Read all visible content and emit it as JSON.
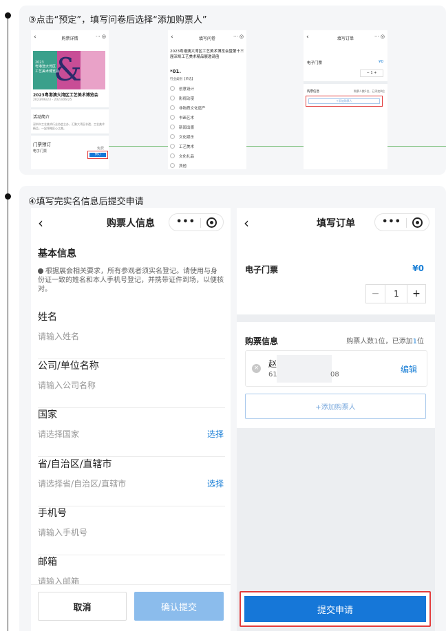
{
  "step3": {
    "title": "③点击“预定”，填写问卷后选择“添加购票人”",
    "screen1": {
      "header": "购票详情",
      "banner_year": "2023",
      "banner_line1": "粤港澳大湾区",
      "banner_line2": "工艺美术博览会",
      "event_title": "2023粤港澳大湾区工艺美术博览会",
      "date": "2023/06/23 - 2023/06/25",
      "intro_heading": "活动简介",
      "intro_text": "深圳市工艺美术行业协会主办，汇聚大湾区非遗、工艺美术精品，一起领略匠心之美。",
      "tickets_heading": "门票预订",
      "ticket_name": "电子门票",
      "price_tag": "免费",
      "book_button": "预订"
    },
    "screen2": {
      "header": "填写问卷",
      "heading": "2023粤港澳大湾区工艺美术博览会暨第十三届深圳工艺美术精品展邀请函",
      "question": "*01.",
      "question_sub": "行业类别【单选】",
      "options": [
        "创意设计",
        "影视动漫",
        "非物质文化遗产",
        "书画艺术",
        "新闻出版",
        "文化娱乐",
        "工艺美术",
        "文化礼品",
        "其他"
      ]
    },
    "screen3": {
      "header": "填写订单",
      "ticket_label": "电子门票",
      "price": "¥0",
      "qty": "1",
      "buyer_label": "购票信息",
      "buyer_count": "购票人数1位，已添加0位",
      "add_button": "+添加购票人"
    }
  },
  "step4": {
    "title": "④填写完实名信息后提交申请",
    "left_screen": {
      "header": "购票人信息",
      "section_title": "基本信息",
      "notice": "根据展会相关要求，所有参观者须实名登记。请使用与身份证一致的姓名和本人手机号登记，并携带证件到场，以便核对。",
      "fields": [
        {
          "label": "姓名",
          "placeholder": "请输入姓名",
          "action": ""
        },
        {
          "label": "公司/单位名称",
          "placeholder": "请输入公司名称",
          "action": ""
        },
        {
          "label": "国家",
          "placeholder": "请选择国家",
          "action": "选择"
        },
        {
          "label": "省/自治区/直辖市",
          "placeholder": "请选择省/自治区/直辖市",
          "action": "选择"
        },
        {
          "label": "手机号",
          "placeholder": "请输入手机号",
          "action": ""
        },
        {
          "label": "邮箱",
          "placeholder": "请输入邮箱",
          "action": ""
        }
      ],
      "cancel_button": "取消",
      "confirm_button": "确认提交"
    },
    "right_screen": {
      "header": "填写订单",
      "ticket_label": "电子门票",
      "price": "¥0",
      "qty": "1",
      "minus": "−",
      "plus": "+",
      "buyer_label": "购票信息",
      "buyer_count_prefix": "购票人数1位，已添加",
      "buyer_count_num": "1",
      "buyer_count_suffix": "位",
      "buyer_name": "赵",
      "buyer_id_start": "61",
      "buyer_id_end": "08",
      "edit": "编辑",
      "add_button": "+添加购票人",
      "submit_button": "提交申请"
    }
  },
  "icons": {
    "back": "‹",
    "more": "•••",
    "delete": "×"
  }
}
